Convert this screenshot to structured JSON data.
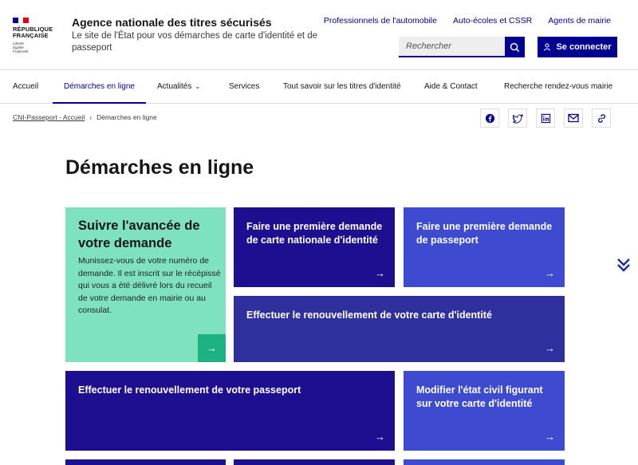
{
  "header": {
    "logo_line1": "RÉPUBLIQUE",
    "logo_line2": "FRANÇAISE",
    "motto_1": "Liberté",
    "motto_2": "Égalité",
    "motto_3": "Fraternité",
    "title": "Agence nationale des titres sécurisés",
    "tagline": "Le site de l'État pour vos démarches de carte d'identité et de passeport",
    "top_links": [
      "Professionnels de l'automobile",
      "Auto-écoles et CSSR",
      "Agents de mairie"
    ],
    "search_placeholder": "Rechercher",
    "login_label": "Se connecter"
  },
  "nav": {
    "items": [
      "Accueil",
      "Démarches en ligne",
      "Actualités",
      "Services",
      "Tout savoir sur les titres d'identité",
      "Aide & Contact",
      "Recherche rendez-vous mairie"
    ]
  },
  "breadcrumb": {
    "home": "CNI-Passeport - Accueil",
    "current": "Démarches en ligne"
  },
  "page": {
    "title": "Démarches en ligne"
  },
  "cards": {
    "suivre_title": "Suivre l'avancée de votre demande",
    "suivre_desc": "Munissez-vous de votre numéro de demande. Il est inscrit sur le récépissé qui vous a été délivré lors du recueil de votre demande en mairie ou au consulat.",
    "cni_first": "Faire une première demande de carte nationale d'identité",
    "passport_first": "Faire une première demande de passeport",
    "cni_renew": "Effectuer le renouvellement de votre carte d'identité",
    "passport_renew": "Effectuer le renouvellement de votre passeport",
    "civil_status": "Modifier l'état civil figurant sur votre carte d'identité"
  },
  "colors": {
    "brand_blue": "#000091",
    "green": "#7ee2c0"
  }
}
